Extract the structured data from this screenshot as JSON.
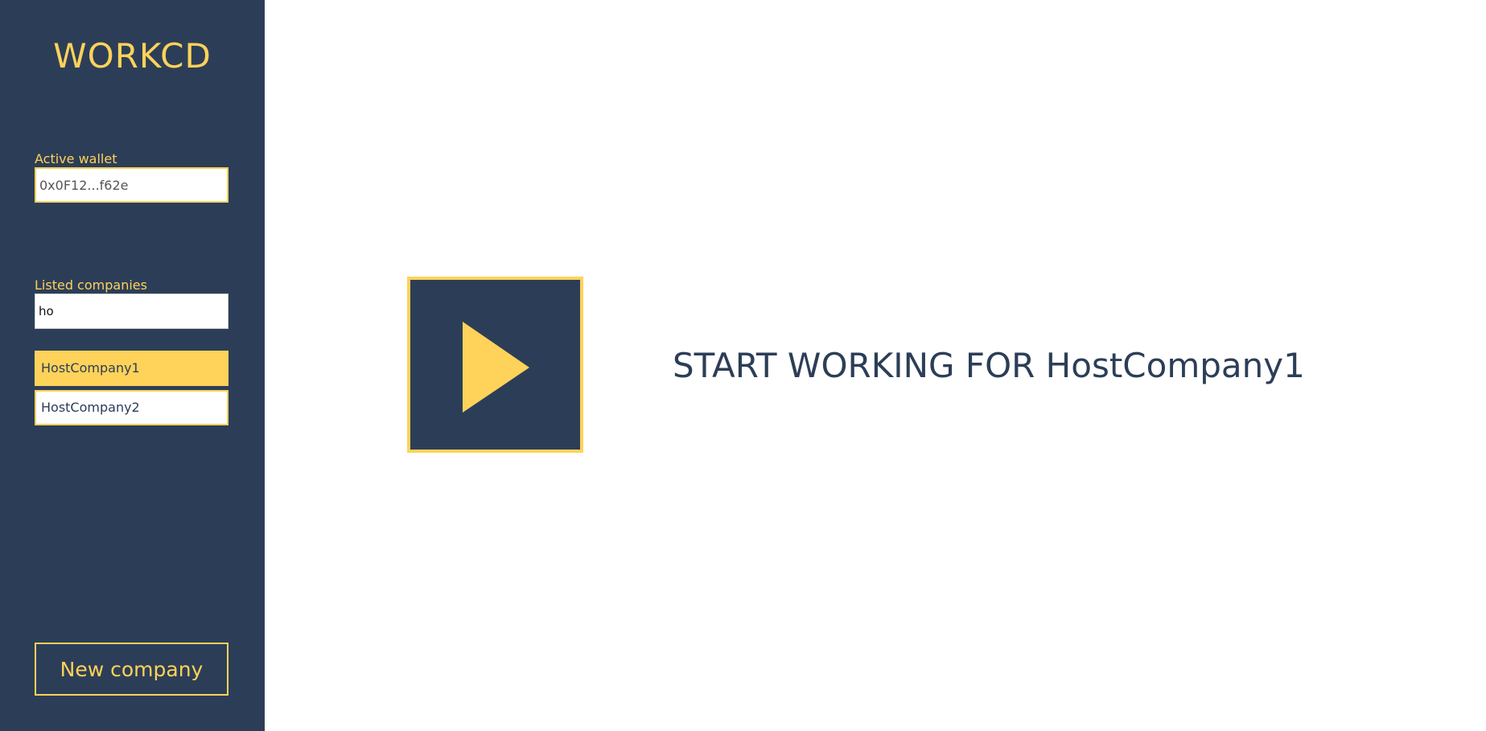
{
  "app": {
    "logo": "WORKCD"
  },
  "sidebar": {
    "wallet": {
      "label": "Active wallet",
      "value": "0x0F12...f62e"
    },
    "companies": {
      "label": "Listed companies",
      "search_value": "ho",
      "items": [
        {
          "label": "HostCompany1",
          "selected": true
        },
        {
          "label": "HostCompany2",
          "selected": false
        }
      ]
    },
    "new_company_label": "New company"
  },
  "main": {
    "play_icon": "play-icon",
    "start_text": "START WORKING FOR HostCompany1"
  },
  "colors": {
    "sidebar_bg": "#2c3e57",
    "accent": "#ffd25a",
    "text_dark": "#2c3e57",
    "background": "#ffffff"
  }
}
